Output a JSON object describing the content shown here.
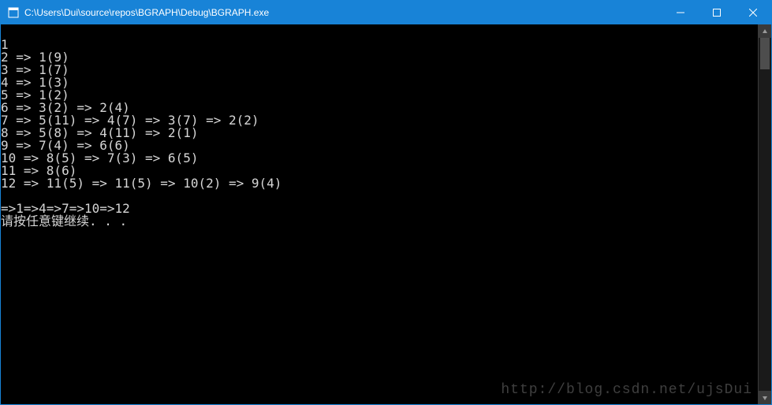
{
  "window": {
    "title": "C:\\Users\\Dui\\source\\repos\\BGRAPH\\Debug\\BGRAPH.exe"
  },
  "console": {
    "lines": [
      "",
      "1",
      "2 => 1(9)",
      "3 => 1(7)",
      "4 => 1(3)",
      "5 => 1(2)",
      "6 => 3(2) => 2(4)",
      "7 => 5(11) => 4(7) => 3(7) => 2(2)",
      "8 => 5(8) => 4(11) => 2(1)",
      "9 => 7(4) => 6(6)",
      "10 => 8(5) => 7(3) => 6(5)",
      "11 => 8(6)",
      "12 => 11(5) => 11(5) => 10(2) => 9(4)",
      "",
      "=>1=>4=>7=>10=>12",
      "请按任意键继续. . ."
    ]
  },
  "watermark": "http://blog.csdn.net/ujsDui"
}
